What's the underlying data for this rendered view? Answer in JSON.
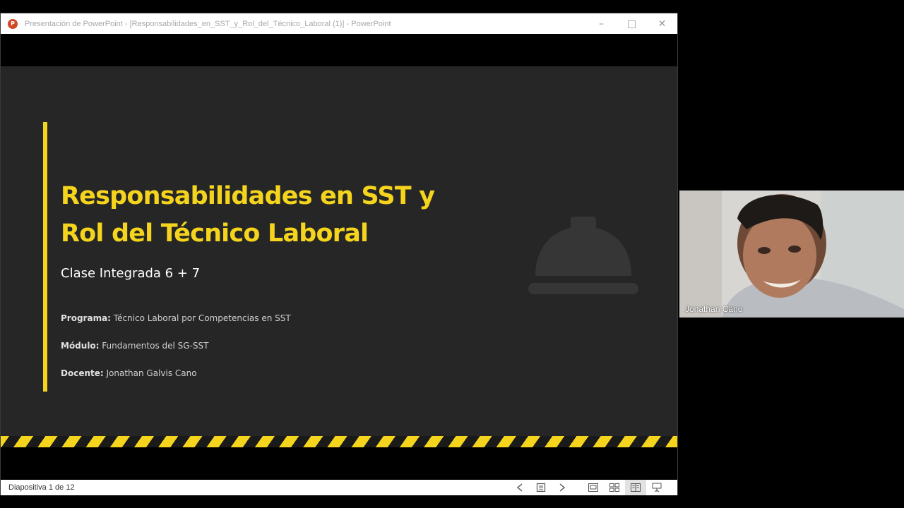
{
  "window": {
    "title": "Presentación de PowerPoint - [Responsabilidades_en_SST_y_Rol_del_Técnico_Laboral (1)] - PowerPoint",
    "app_icon_letter": "P",
    "minimize_glyph": "–",
    "maximize_glyph": "□",
    "close_glyph": "✕"
  },
  "slide": {
    "title_line1": "Responsabilidades en SST y",
    "title_line2": "Rol del Técnico Laboral",
    "subtitle": "Clase Integrada 6 + 7",
    "info": [
      {
        "label": "Programa:",
        "value": " Técnico Laboral por Competencias en SST"
      },
      {
        "label": "Módulo:",
        "value": " Fundamentos del SG-SST"
      },
      {
        "label": "Docente:",
        "value": " Jonathan Galvis Cano"
      }
    ],
    "accent_color": "#f5d41d",
    "background_color": "#262626",
    "decorative_icon": "hard-hat-icon"
  },
  "statusbar": {
    "slide_counter": "Diapositiva 1 de 12",
    "icons": [
      "previous-slide-icon",
      "slide-menu-icon",
      "next-slide-icon",
      "normal-view-icon",
      "slide-sorter-icon",
      "reading-view-icon",
      "slideshow-icon"
    ]
  },
  "video": {
    "participant_name": "Jonathan Cano"
  }
}
